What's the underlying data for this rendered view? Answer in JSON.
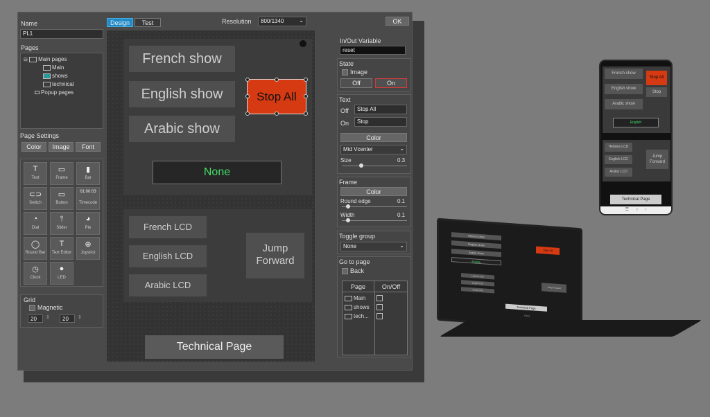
{
  "left": {
    "name_label": "Name",
    "name_value": "PL1",
    "pages_label": "Pages",
    "tree": [
      "Main pages",
      "Main",
      "shows",
      "technical",
      "Popup pages"
    ],
    "page_settings_label": "Page Settings",
    "color_btn": "Color",
    "image_btn": "Image",
    "font_btn": "Font",
    "tools": [
      "Text",
      "Frame",
      "Bar",
      "Switch",
      "Button",
      "Timecode",
      "Dial",
      "Slider",
      "Pie",
      "Round Bar",
      "Text Editor",
      "Joystick",
      "Clock",
      "LED"
    ],
    "tool_glyphs": [
      "T",
      "▭",
      "▮",
      "⊂⊃",
      "▭",
      "01:00:03",
      "◔",
      "⫯",
      "◕",
      "◯",
      "T",
      "⊕",
      "◷",
      "●"
    ],
    "grid_label": "Grid",
    "magnetic_label": "Magnetic",
    "grid_x": "20",
    "grid_y": "20"
  },
  "top": {
    "design_tab": "Design",
    "test_tab": "Test",
    "resolution_label": "Resolution",
    "resolution_value": "800/1340",
    "ok_btn": "OK"
  },
  "canvas": {
    "french_show": "French show",
    "english_show": "English show",
    "arabic_show": "Arabic show",
    "stop_all": "Stop All",
    "none_label": "None",
    "french_lcd": "French LCD",
    "english_lcd": "English LCD",
    "arabic_lcd": "Arabic LCD",
    "jump_forward_1": "Jump",
    "jump_forward_2": "Forward",
    "technical_page": "Technical Page"
  },
  "right": {
    "inout_label": "In/Out Variable",
    "inout_value": "reset",
    "state_label": "State",
    "image_label": "Image",
    "off_btn": "Off",
    "on_btn": "On",
    "text_label": "Text",
    "off_label": "Off",
    "off_value": "Stop All",
    "on_label": "On",
    "on_value": "Stop",
    "color_btn": "Color",
    "align_value": "Mid Vcenter",
    "size_label": "Size",
    "size_value": "0.3",
    "frame_label": "Frame",
    "frame_color_btn": "Color",
    "round_edge_label": "Round edge",
    "round_edge_value": "0.1",
    "width_label": "Width",
    "width_value": "0.1",
    "toggle_label": "Toggle group",
    "toggle_value": "None",
    "goto_label": "Go to page",
    "back_label": "Back",
    "col_page": "Page",
    "col_onoff": "On/Off",
    "pages": [
      "Main",
      "shows",
      "tech..."
    ]
  },
  "phone": {
    "french_show": "French show",
    "english_show": "English show",
    "arabic_show": "Arabic show",
    "stop_all": "Stop All",
    "stop": "Stop",
    "english": "English",
    "hebrew_lcd": "Hebrew LCD",
    "english_lcd": "English LCD",
    "arabic_lcd": "Arabic LCD",
    "jump_forward": "Jump Forward",
    "technical_page": "Technical Page"
  },
  "laptop": {
    "hebrew_show": "Hebrew show",
    "english_show": "English show",
    "arabic_show": "Arabic show",
    "stop_all": "Stop All",
    "english": "English",
    "hebrew_lcd": "Hebrew LCD",
    "english_lcd": "English LCD",
    "arabic_lcd": "Arabic LCD",
    "jump_forward": "Jump Forward",
    "technical_page": "Technical Page",
    "status": "Status"
  },
  "colors": {
    "accent_red": "#d63a12",
    "led_green": "#44dd66",
    "tab_blue": "#1e8ac8"
  }
}
